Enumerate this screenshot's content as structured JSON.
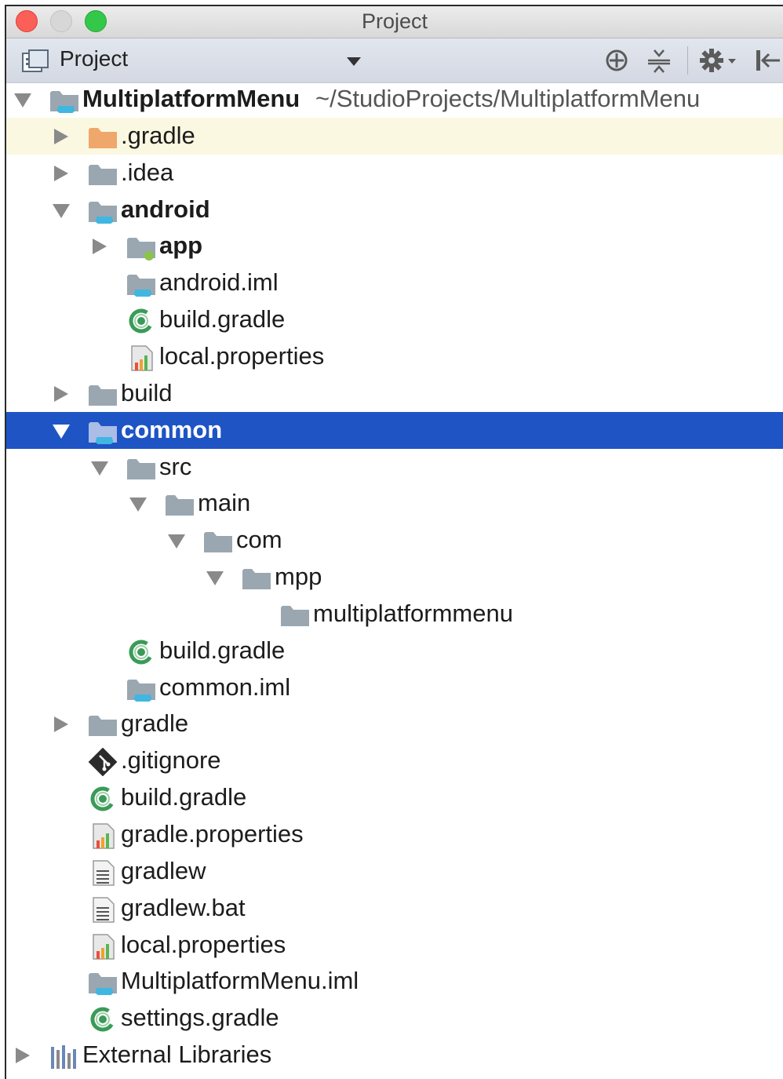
{
  "window": {
    "title": "Project"
  },
  "toolbar": {
    "view_label": "Project",
    "icons": [
      "project-view-icon",
      "locate-icon",
      "collapse-all-icon",
      "settings-gear-icon",
      "hide-panel-icon"
    ]
  },
  "colors": {
    "selection": "#1f54c5",
    "highlight_row": "#fbf8e1",
    "folder": "#9aa7b0",
    "excluded_folder": "#f0a76b",
    "module_badge": "#40b6e0",
    "gradle_green": "#3a9b58"
  },
  "tree": [
    {
      "label": "MultiplatformMenu",
      "path": "~/StudioProjects/MultiplatformMenu",
      "icon": "module-folder-icon",
      "arrow": "down",
      "bold": true
    },
    {
      "label": ".gradle",
      "icon": "excluded-folder-icon",
      "arrow": "right",
      "highlight": true
    },
    {
      "label": ".idea",
      "icon": "folder-icon",
      "arrow": "right"
    },
    {
      "label": "android",
      "icon": "module-folder-icon",
      "arrow": "down",
      "bold": true
    },
    {
      "label": "app",
      "icon": "app-module-folder-icon",
      "arrow": "right",
      "bold": true
    },
    {
      "label": "android.iml",
      "icon": "iml-file-icon",
      "arrow": "none"
    },
    {
      "label": "build.gradle",
      "icon": "gradle-file-icon",
      "arrow": "none"
    },
    {
      "label": "local.properties",
      "icon": "properties-file-icon",
      "arrow": "none"
    },
    {
      "label": "build",
      "icon": "folder-icon",
      "arrow": "right"
    },
    {
      "label": "common",
      "icon": "module-folder-icon",
      "arrow": "down",
      "bold": true,
      "selected": true
    },
    {
      "label": "src",
      "icon": "folder-icon",
      "arrow": "down"
    },
    {
      "label": "main",
      "icon": "folder-icon",
      "arrow": "down"
    },
    {
      "label": "com",
      "icon": "folder-icon",
      "arrow": "down"
    },
    {
      "label": "mpp",
      "icon": "folder-icon",
      "arrow": "down"
    },
    {
      "label": "multiplatformmenu",
      "icon": "folder-icon",
      "arrow": "none"
    },
    {
      "label": "build.gradle",
      "icon": "gradle-file-icon",
      "arrow": "none"
    },
    {
      "label": "common.iml",
      "icon": "iml-file-icon",
      "arrow": "none"
    },
    {
      "label": "gradle",
      "icon": "folder-icon",
      "arrow": "right"
    },
    {
      "label": ".gitignore",
      "icon": "gitignore-file-icon",
      "arrow": "none"
    },
    {
      "label": "build.gradle",
      "icon": "gradle-file-icon",
      "arrow": "none"
    },
    {
      "label": "gradle.properties",
      "icon": "properties-file-icon",
      "arrow": "none"
    },
    {
      "label": "gradlew",
      "icon": "text-file-icon",
      "arrow": "none"
    },
    {
      "label": "gradlew.bat",
      "icon": "text-file-icon",
      "arrow": "none"
    },
    {
      "label": "local.properties",
      "icon": "properties-file-icon",
      "arrow": "none"
    },
    {
      "label": "MultiplatformMenu.iml",
      "icon": "iml-file-icon",
      "arrow": "none"
    },
    {
      "label": "settings.gradle",
      "icon": "gradle-file-icon",
      "arrow": "none"
    },
    {
      "label": "External Libraries",
      "icon": "libraries-icon",
      "arrow": "right"
    }
  ]
}
